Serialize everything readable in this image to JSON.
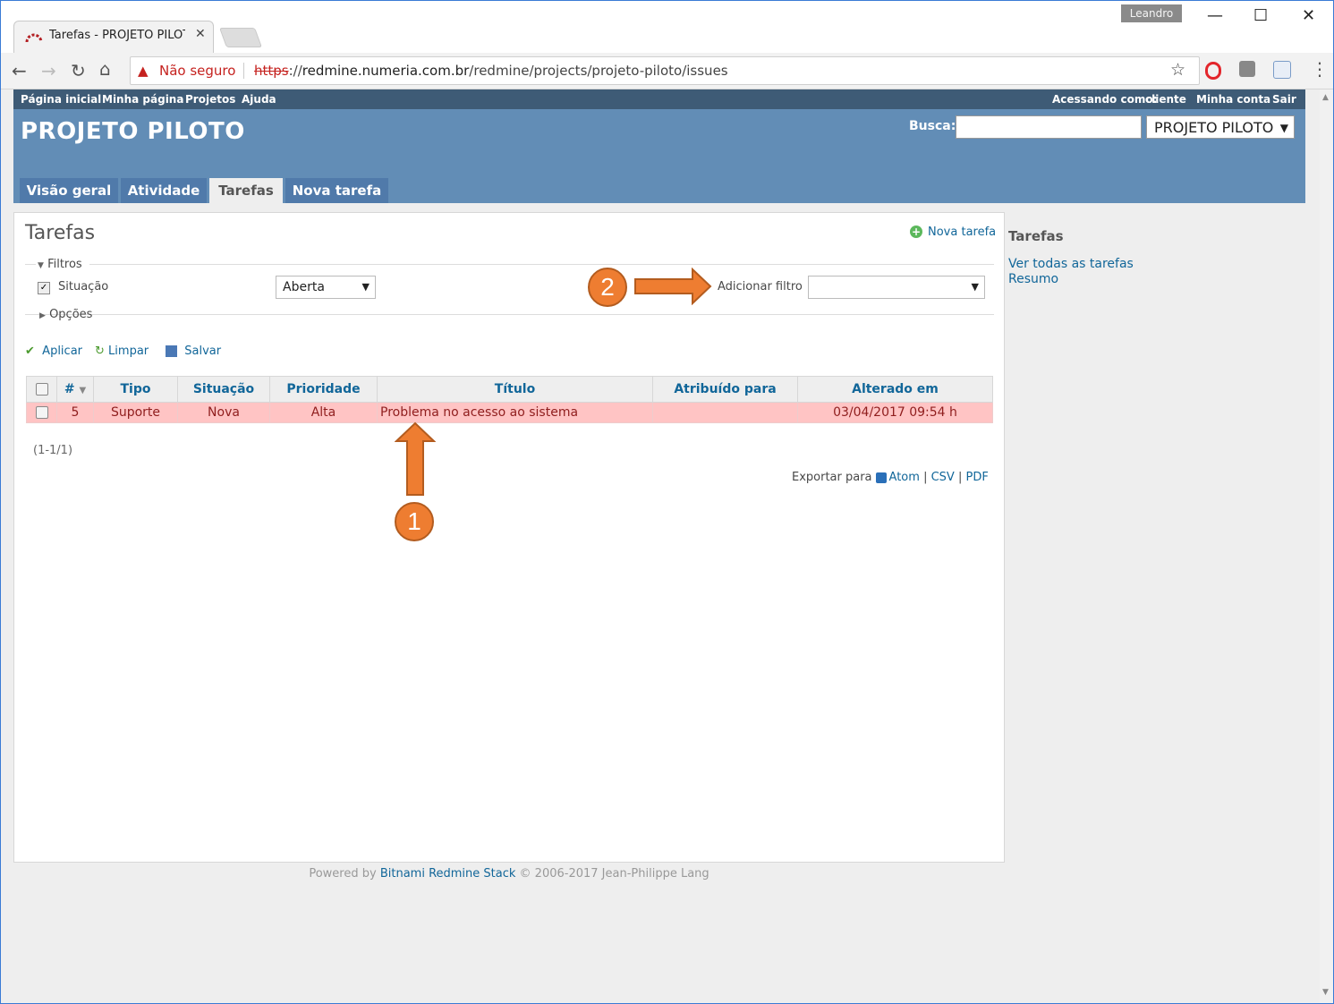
{
  "browser": {
    "tab_title": "Tarefas - PROJETO PILOTO",
    "user_badge": "Leandro",
    "not_secure": "Não seguro",
    "url_scheme": "https",
    "url_sep": "://",
    "url_domain": "redmine.numeria.com.br",
    "url_path": "/redmine/projects/projeto-piloto/issues"
  },
  "top_menu": {
    "left": [
      "Página inicial",
      "Minha página",
      "Projetos",
      "Ajuda"
    ],
    "logged_as_label": "Acessando como:",
    "logged_user": "cliente",
    "my_account": "Minha conta",
    "logout": "Sair"
  },
  "header": {
    "project_title": "PROJETO PILOTO",
    "search_label": "Busca:",
    "project_select": "PROJETO PILOTO"
  },
  "main_tabs": [
    "Visão geral",
    "Atividade",
    "Tarefas",
    "Nova tarefa"
  ],
  "content": {
    "title": "Tarefas",
    "new_issue": "Nova tarefa",
    "filters_legend": "Filtros",
    "filter_label": "Situação",
    "filter_value": "Aberta",
    "add_filter_label": "Adicionar filtro",
    "options_legend": "Opções",
    "apply": "Aplicar",
    "clear": "Limpar",
    "save": "Salvar",
    "table": {
      "columns": [
        "#",
        "Tipo",
        "Situação",
        "Prioridade",
        "Título",
        "Atribuído para",
        "Alterado em"
      ],
      "rows": [
        {
          "id": "5",
          "tipo": "Suporte",
          "situacao": "Nova",
          "prioridade": "Alta",
          "titulo": "Problema no acesso ao sistema",
          "atribuido": "",
          "alterado": "03/04/2017 09:54 h"
        }
      ]
    },
    "pagination": "(1-1/1)",
    "export_label": "Exportar para",
    "export_atom": "Atom",
    "export_csv": "CSV",
    "export_pdf": "PDF",
    "export_sep": "|"
  },
  "sidebar": {
    "title": "Tarefas",
    "links": [
      "Ver todas as tarefas",
      "Resumo"
    ]
  },
  "footer": {
    "powered_by": "Powered by",
    "link": "Bitnami Redmine Stack",
    "copyright": "© 2006-2017 Jean-Philippe Lang"
  },
  "annotations": {
    "callout_1": "1",
    "callout_2": "2",
    "color": "#ee7d31"
  }
}
